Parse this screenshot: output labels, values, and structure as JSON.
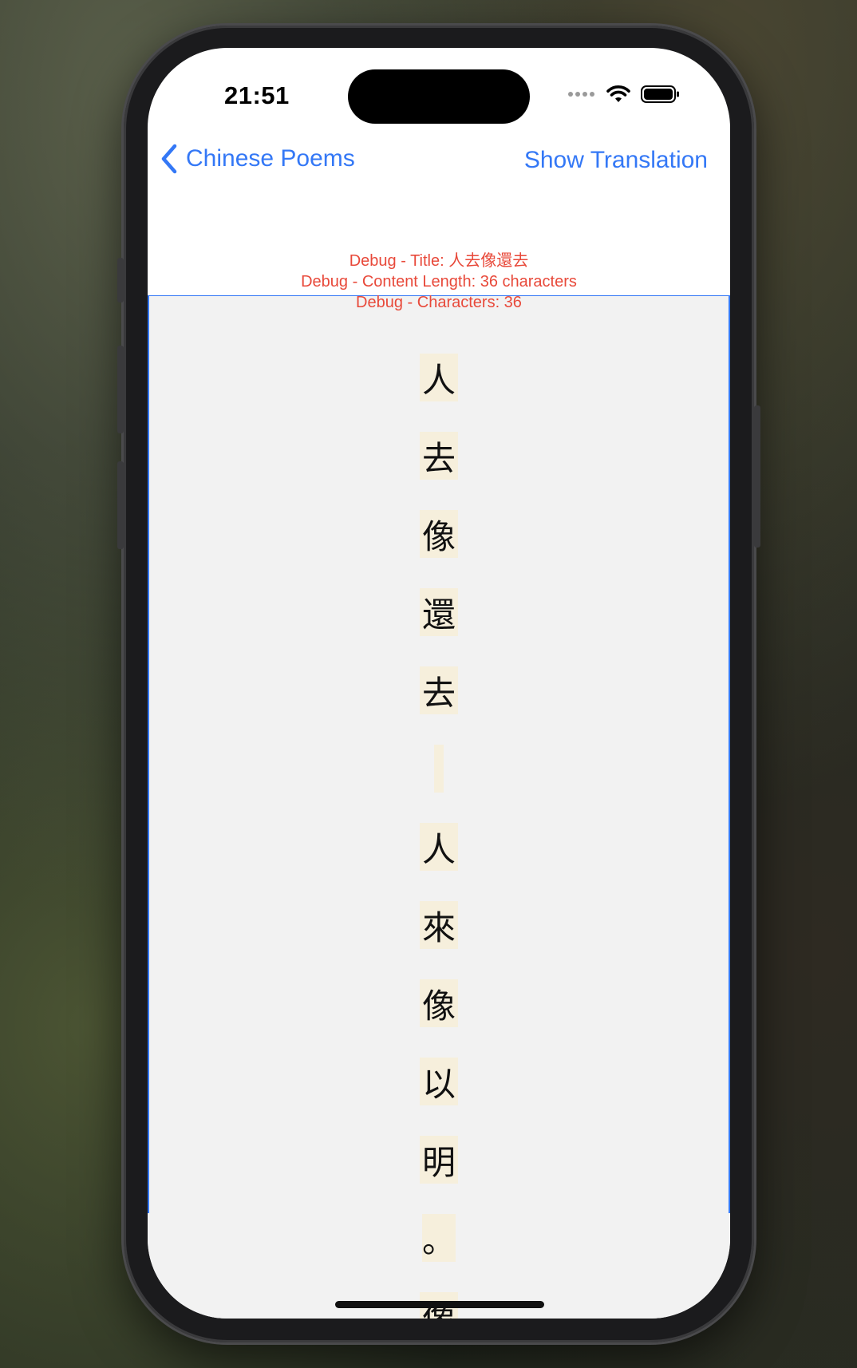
{
  "status_bar": {
    "time": "21:51",
    "signal_icon": "signal-dots-icon",
    "wifi_icon": "wifi-icon",
    "battery_icon": "battery-icon"
  },
  "nav": {
    "back_icon": "chevron-left-icon",
    "back_label": "Chinese Poems",
    "right_label": "Show Translation"
  },
  "debug": {
    "title_line": "Debug - Title: 人去像還去",
    "length_line": "Debug - Content Length: 36 characters",
    "count_line": "Debug - Characters: 36"
  },
  "poem": {
    "characters": [
      "人",
      "去",
      "像",
      "還",
      "去",
      "",
      "人",
      "來",
      "像",
      "以",
      "明",
      "。",
      "像"
    ]
  },
  "colors": {
    "accent": "#3478f6",
    "debug_text": "#e8493a",
    "char_highlight": "#f6efdc",
    "content_background": "#f2f2f2"
  }
}
